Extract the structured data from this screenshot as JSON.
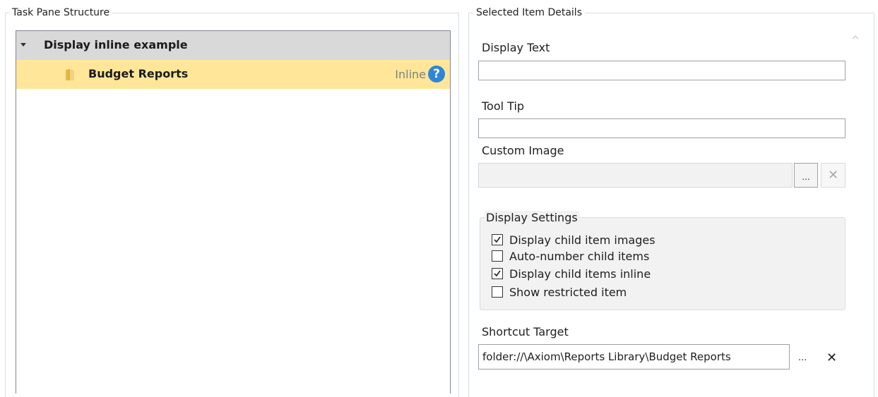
{
  "task_pane": {
    "title": "Task Pane Structure",
    "root_item": {
      "label": "Display inline example"
    },
    "child_item": {
      "label": "Budget Reports",
      "badge": "Inline",
      "help_glyph": "?"
    }
  },
  "details": {
    "title": "Selected Item Details",
    "display_text": {
      "label": "Display Text",
      "value": ""
    },
    "tool_tip": {
      "label": "Tool Tip",
      "value": ""
    },
    "custom_image": {
      "label": "Custom Image",
      "value": "",
      "browse_label": "...",
      "clear_label": "✕"
    },
    "display_settings": {
      "title": "Display Settings",
      "options": [
        {
          "label": "Display child item images",
          "checked": true
        },
        {
          "label": "Auto-number child items",
          "checked": false
        },
        {
          "label": "Display child items inline",
          "checked": true
        },
        {
          "label": "Show restricted item",
          "checked": false
        }
      ]
    },
    "shortcut_target": {
      "label": "Shortcut Target",
      "value": "folder://\\Axiom\\Reports Library\\Budget Reports",
      "browse_label": "...",
      "clear_label": "✕"
    }
  },
  "colors": {
    "selected_row": "#ffe699",
    "root_row": "#d9d9d9",
    "help_icon": "#2f86d6"
  }
}
